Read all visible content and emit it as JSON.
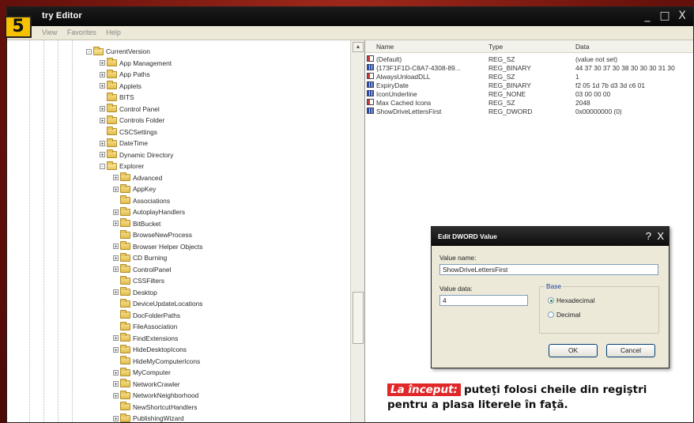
{
  "step_badge": "5",
  "window": {
    "title": "try Editor",
    "controls": [
      "_",
      "□",
      "X"
    ]
  },
  "menubar": {
    "items": [
      "View",
      "Favorites",
      "Help"
    ]
  },
  "tree": {
    "items": [
      {
        "label": "CurrentVersion",
        "level": 0,
        "expander": "-",
        "open": true
      },
      {
        "label": "App Management",
        "level": 1,
        "expander": "+"
      },
      {
        "label": "App Paths",
        "level": 1,
        "expander": "+"
      },
      {
        "label": "Applets",
        "level": 1,
        "expander": "+"
      },
      {
        "label": "BITS",
        "level": 1,
        "expander": ""
      },
      {
        "label": "Control Panel",
        "level": 1,
        "expander": "+"
      },
      {
        "label": "Controls Folder",
        "level": 1,
        "expander": "+"
      },
      {
        "label": "CSCSettings",
        "level": 1,
        "expander": ""
      },
      {
        "label": "DateTime",
        "level": 1,
        "expander": "+"
      },
      {
        "label": "Dynamic Directory",
        "level": 1,
        "expander": "+"
      },
      {
        "label": "Explorer",
        "level": 1,
        "expander": "-",
        "open": true
      },
      {
        "label": "Advanced",
        "level": 2,
        "expander": "+"
      },
      {
        "label": "AppKey",
        "level": 2,
        "expander": "+"
      },
      {
        "label": "Associations",
        "level": 2,
        "expander": ""
      },
      {
        "label": "AutoplayHandlers",
        "level": 2,
        "expander": "+"
      },
      {
        "label": "BitBucket",
        "level": 2,
        "expander": "+"
      },
      {
        "label": "BrowseNewProcess",
        "level": 2,
        "expander": ""
      },
      {
        "label": "Browser Helper Objects",
        "level": 2,
        "expander": "+"
      },
      {
        "label": "CD Burning",
        "level": 2,
        "expander": "+"
      },
      {
        "label": "ControlPanel",
        "level": 2,
        "expander": "+"
      },
      {
        "label": "CSSFilters",
        "level": 2,
        "expander": ""
      },
      {
        "label": "Desktop",
        "level": 2,
        "expander": "+"
      },
      {
        "label": "DeviceUpdateLocations",
        "level": 2,
        "expander": ""
      },
      {
        "label": "DocFolderPaths",
        "level": 2,
        "expander": ""
      },
      {
        "label": "FileAssociation",
        "level": 2,
        "expander": ""
      },
      {
        "label": "FindExtensions",
        "level": 2,
        "expander": "+"
      },
      {
        "label": "HideDesktopIcons",
        "level": 2,
        "expander": "+"
      },
      {
        "label": "HideMyComputerIcons",
        "level": 2,
        "expander": ""
      },
      {
        "label": "MyComputer",
        "level": 2,
        "expander": "+"
      },
      {
        "label": "NetworkCrawler",
        "level": 2,
        "expander": "+"
      },
      {
        "label": "NetworkNeighborhood",
        "level": 2,
        "expander": "+"
      },
      {
        "label": "NewShortcutHandlers",
        "level": 2,
        "expander": ""
      },
      {
        "label": "PublishingWizard",
        "level": 2,
        "expander": "+"
      }
    ]
  },
  "values_list": {
    "headers": {
      "name": "Name",
      "type": "Type",
      "data": "Data"
    },
    "rows": [
      {
        "name": "(Default)",
        "type": "REG_SZ",
        "data": "(value not set)",
        "icon": "sz"
      },
      {
        "name": "{173F1F1D-C8A7-4308-89...",
        "type": "REG_BINARY",
        "data": "44 37 30 37 30 38 30 30 30 31 30",
        "icon": "bin"
      },
      {
        "name": "AlwaysUnloadDLL",
        "type": "REG_SZ",
        "data": "1",
        "icon": "sz"
      },
      {
        "name": "ExpiryDate",
        "type": "REG_BINARY",
        "data": "f2 05 1d 7b d3 3d c6 01",
        "icon": "bin"
      },
      {
        "name": "IconUnderline",
        "type": "REG_NONE",
        "data": "03 00 00 00",
        "icon": "bin"
      },
      {
        "name": "Max Cached Icons",
        "type": "REG_SZ",
        "data": "2048",
        "icon": "sz"
      },
      {
        "name": "ShowDriveLettersFirst",
        "type": "REG_DWORD",
        "data": "0x00000000 (0)",
        "icon": "bin"
      }
    ]
  },
  "dialog": {
    "title": "Edit DWORD Value",
    "help": "?",
    "close": "X",
    "value_name_label": "Value name:",
    "value_name": "ShowDriveLettersFirst",
    "value_data_label": "Value data:",
    "value_data": "4",
    "base_label": "Base",
    "radio_hex": "Hexadecimal",
    "radio_dec": "Decimal",
    "base_selected": "Hexadecimal",
    "ok": "OK",
    "cancel": "Cancel"
  },
  "caption": {
    "highlight": "La început:",
    "text": "puteţi folosi cheile din regiştri pentru a plasa literele în faţă."
  },
  "colors": {
    "badge": "#f5c100",
    "caption_highlight": "#e0282a",
    "frame": "#7a1410"
  }
}
